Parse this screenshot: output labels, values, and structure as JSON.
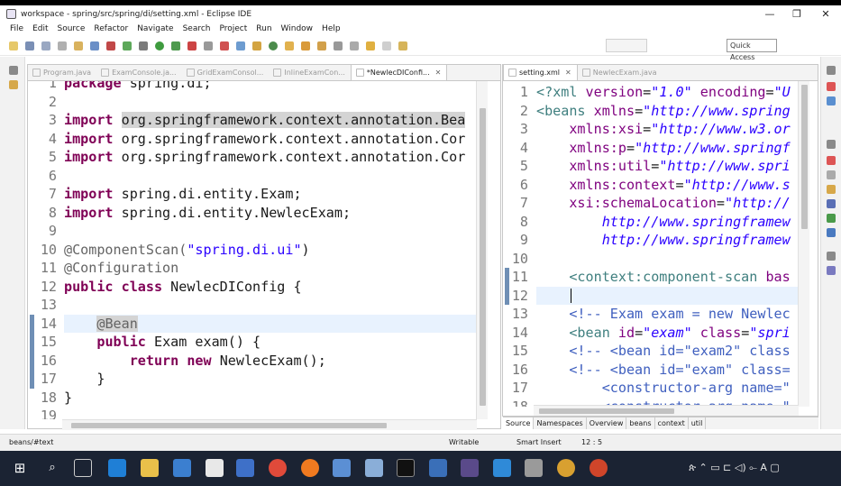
{
  "window": {
    "title": "workspace - spring/src/spring/di/setting.xml - Eclipse IDE",
    "controls": [
      "—",
      "❐",
      "✕"
    ]
  },
  "menu": [
    "File",
    "Edit",
    "Source",
    "Refactor",
    "Navigate",
    "Search",
    "Project",
    "Run",
    "Window",
    "Help"
  ],
  "toolbar": {
    "quick_access": "Quick Access"
  },
  "left_editor": {
    "tabs": [
      {
        "label": "Program.java",
        "active": false
      },
      {
        "label": "ExamConsole.ja...",
        "active": false
      },
      {
        "label": "GridExamConsol...",
        "active": false
      },
      {
        "label": "InlineExamCon...",
        "active": false
      },
      {
        "label": "*NewlecDIConfi...",
        "active": true,
        "close": "✕"
      }
    ],
    "line_numbers": [
      "1",
      "2",
      "3",
      "4",
      "5",
      "6",
      "7",
      "8",
      "9",
      "10",
      "11",
      "12",
      "13",
      "14",
      "15",
      "16",
      "17",
      "18",
      "19"
    ],
    "lines": [
      [
        {
          "t": "package ",
          "c": "kw"
        },
        {
          "t": "spring.di;",
          "c": ""
        }
      ],
      [],
      [
        {
          "t": "import ",
          "c": "kw"
        },
        {
          "t": "org.springframework.context.annotation.Bea",
          "c": "sel"
        }
      ],
      [
        {
          "t": "import ",
          "c": "kw"
        },
        {
          "t": "org.springframework.context.annotation.Cor",
          "c": ""
        }
      ],
      [
        {
          "t": "import ",
          "c": "kw"
        },
        {
          "t": "org.springframework.context.annotation.Cor",
          "c": ""
        }
      ],
      [],
      [
        {
          "t": "import ",
          "c": "kw"
        },
        {
          "t": "spring.di.entity.Exam;",
          "c": ""
        }
      ],
      [
        {
          "t": "import ",
          "c": "kw"
        },
        {
          "t": "spring.di.entity.NewlecExam;",
          "c": ""
        }
      ],
      [],
      [
        {
          "t": "@ComponentScan(",
          "c": "ann"
        },
        {
          "t": "\"spring.di.ui\"",
          "c": "str"
        },
        {
          "t": ") ",
          "c": ""
        }
      ],
      [
        {
          "t": "@Configuration",
          "c": "ann"
        }
      ],
      [
        {
          "t": "public ",
          "c": "kw"
        },
        {
          "t": "class ",
          "c": "kw"
        },
        {
          "t": "NewlecDIConfig {",
          "c": ""
        }
      ],
      [],
      [
        {
          "t": "    ",
          "c": ""
        },
        {
          "t": "@Bean",
          "c": "ann sel"
        }
      ],
      [
        {
          "t": "    ",
          "c": ""
        },
        {
          "t": "public ",
          "c": "kw"
        },
        {
          "t": "Exam exam() {",
          "c": ""
        }
      ],
      [
        {
          "t": "        ",
          "c": ""
        },
        {
          "t": "return ",
          "c": "kw"
        },
        {
          "t": "new ",
          "c": "kw"
        },
        {
          "t": "NewlecExam();",
          "c": ""
        }
      ],
      [
        {
          "t": "    }",
          "c": ""
        }
      ],
      [
        {
          "t": "}",
          "c": ""
        }
      ],
      []
    ]
  },
  "right_editor": {
    "tabs": [
      {
        "label": "setting.xml",
        "active": true,
        "close": "✕"
      },
      {
        "label": "NewlecExam.java",
        "active": false
      }
    ],
    "line_numbers": [
      "1",
      "2",
      "3",
      "4",
      "5",
      "6",
      "7",
      "8",
      "9",
      "10",
      "11",
      "12",
      "13",
      "14",
      "15",
      "16",
      "17",
      "18"
    ],
    "lines": [
      [
        {
          "t": "<?",
          "c": "xtag"
        },
        {
          "t": "xml ",
          "c": "xtag"
        },
        {
          "t": "version",
          "c": "xattr"
        },
        {
          "t": "=",
          "c": ""
        },
        {
          "t": "\"1.0\"",
          "c": "xval"
        },
        {
          "t": " encoding",
          "c": "xattr"
        },
        {
          "t": "=",
          "c": ""
        },
        {
          "t": "\"U",
          "c": "xval"
        }
      ],
      [
        {
          "t": "<beans ",
          "c": "xtag"
        },
        {
          "t": "xmlns",
          "c": "xattr"
        },
        {
          "t": "=",
          "c": ""
        },
        {
          "t": "\"http://www.spring",
          "c": "xval"
        }
      ],
      [
        {
          "t": "    xmlns:xsi",
          "c": "xattr"
        },
        {
          "t": "=",
          "c": ""
        },
        {
          "t": "\"http://www.w3.or",
          "c": "xval"
        }
      ],
      [
        {
          "t": "    xmlns:p",
          "c": "xattr"
        },
        {
          "t": "=",
          "c": ""
        },
        {
          "t": "\"http://www.springf",
          "c": "xval"
        }
      ],
      [
        {
          "t": "    xmlns:util",
          "c": "xattr"
        },
        {
          "t": "=",
          "c": ""
        },
        {
          "t": "\"http://www.spri",
          "c": "xval"
        }
      ],
      [
        {
          "t": "    xmlns:context",
          "c": "xattr"
        },
        {
          "t": "=",
          "c": ""
        },
        {
          "t": "\"http://www.s",
          "c": "xval"
        }
      ],
      [
        {
          "t": "    xsi:schemaLocation",
          "c": "xattr"
        },
        {
          "t": "=",
          "c": ""
        },
        {
          "t": "\"http://",
          "c": "xval"
        }
      ],
      [
        {
          "t": "        http://www.springframew",
          "c": "xval"
        }
      ],
      [
        {
          "t": "        http://www.springframew",
          "c": "xval"
        }
      ],
      [],
      [
        {
          "t": "    <context:component-scan ",
          "c": "xtag"
        },
        {
          "t": "bas",
          "c": "xattr"
        }
      ],
      [],
      [
        {
          "t": "    <!-- Exam exam = new Newlec",
          "c": "xcom"
        }
      ],
      [
        {
          "t": "    <bean ",
          "c": "xtag"
        },
        {
          "t": "id",
          "c": "xattr"
        },
        {
          "t": "=",
          "c": ""
        },
        {
          "t": "\"exam\"",
          "c": "xval"
        },
        {
          "t": " class",
          "c": "xattr"
        },
        {
          "t": "=",
          "c": ""
        },
        {
          "t": "\"spri",
          "c": "xval"
        }
      ],
      [
        {
          "t": "    <!-- <bean id=\"exam2\" class",
          "c": "xcom"
        }
      ],
      [
        {
          "t": "    <!-- <bean id=\"exam\" class=",
          "c": "xcom"
        }
      ],
      [
        {
          "t": "        <constructor-arg name=\"",
          "c": "xcom"
        }
      ],
      [
        {
          "t": "        <constructor-arg name=\"",
          "c": "xcom"
        }
      ]
    ],
    "bottom_tabs": [
      "Source",
      "Namespaces",
      "Overview",
      "beans",
      "context",
      "util"
    ]
  },
  "status": {
    "path": "beans/#text",
    "mode": "Writable",
    "insert": "Smart Insert",
    "position": "12 : 5"
  },
  "taskbar": {
    "tray": "ጵ  ⌃  ▭  ⊏  ◁)  ⟜  A  ▢"
  }
}
